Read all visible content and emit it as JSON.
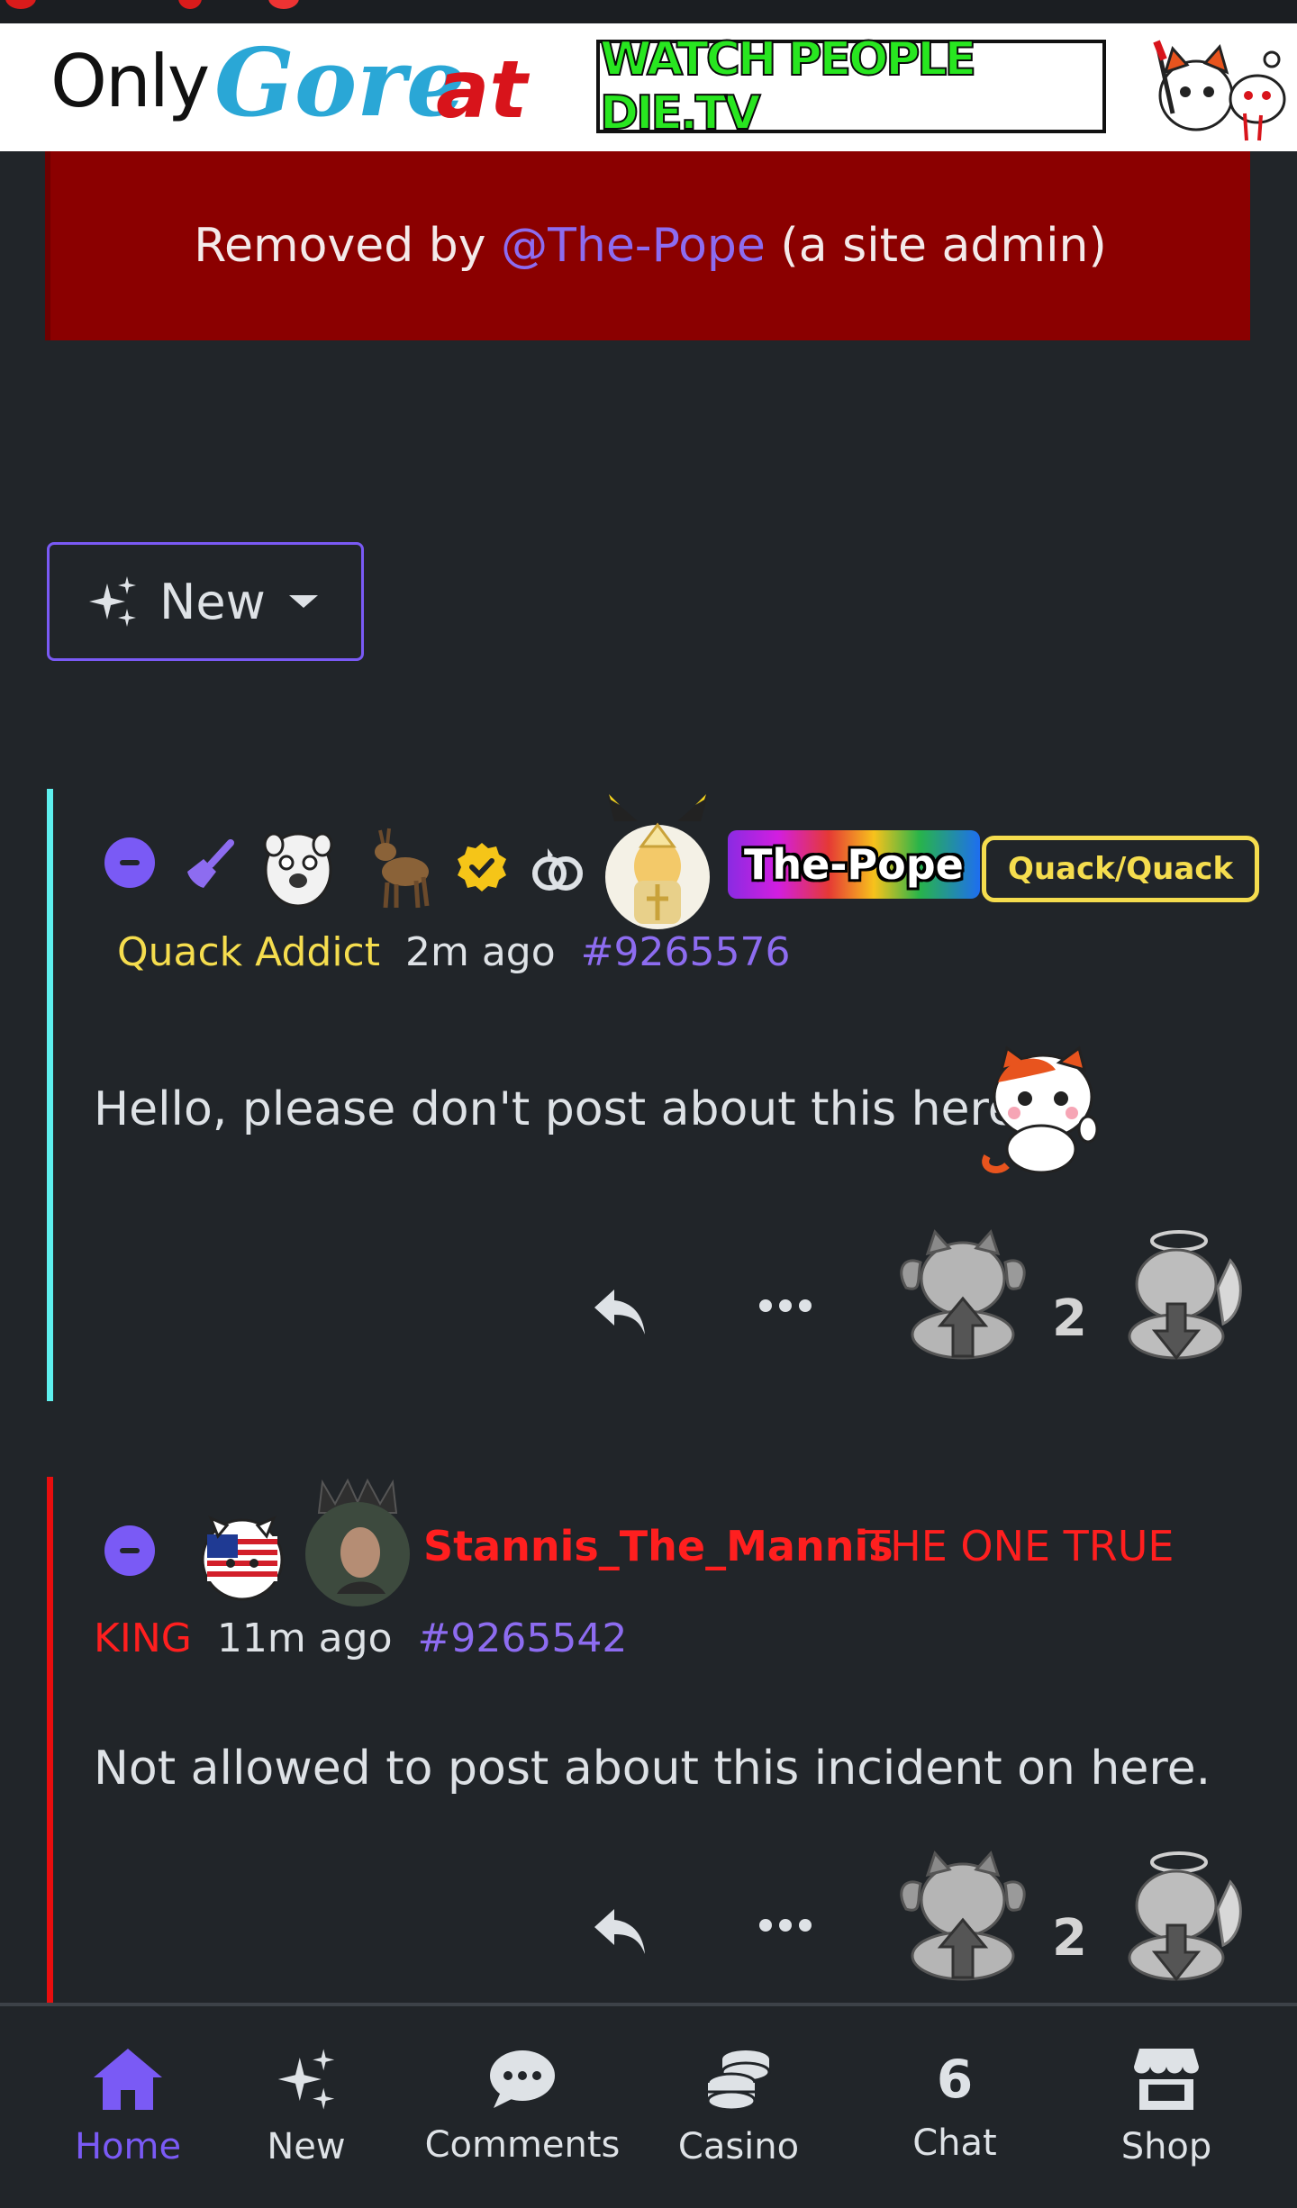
{
  "banner": {
    "logo_only": "Only",
    "logo_gore": "Gore",
    "logo_at": "at",
    "site_button": "WATCH PEOPLE DIE.TV"
  },
  "removal": {
    "prefix": "Removed by",
    "mention": "@The-Pope",
    "suffix": "(a site admin)"
  },
  "sort": {
    "label": "New"
  },
  "comments": [
    {
      "username": "The-Pope",
      "badge": "Quack/Quack",
      "flair": "Quack Addict",
      "time": "2m ago",
      "id": "#9265576",
      "body": "Hello, please don't post about this here",
      "score": "2",
      "bar_color": "#5ef0ee"
    },
    {
      "username": "Stannis_The_Mannis",
      "title_line1": "THE ONE TRUE",
      "title_line2": "KING",
      "avatar_caption": "the one true",
      "time": "11m ago",
      "id": "#9265542",
      "body": "Not allowed to post about this incident on here.",
      "score": "2",
      "bar_color": "#e80e0e"
    }
  ],
  "nav": {
    "home": "Home",
    "new": "New",
    "comments": "Comments",
    "casino": "Casino",
    "chat_count": "6",
    "chat": "Chat",
    "shop": "Shop"
  },
  "colors": {
    "accent": "#7a5af5",
    "background": "#212529",
    "removed_bg": "#8b0000",
    "flair_yellow": "#f5dd4e",
    "red": "#ff1f1f"
  }
}
